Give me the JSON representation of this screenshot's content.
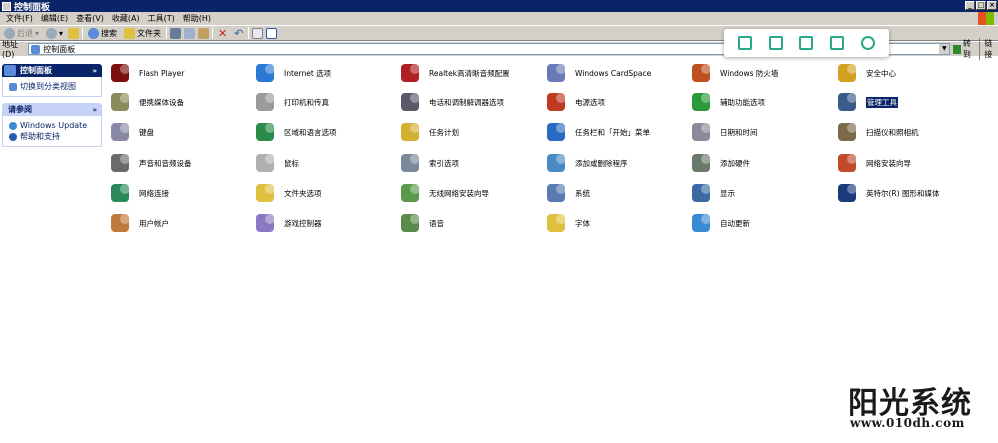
{
  "window": {
    "title": "控制面板"
  },
  "menu": [
    "文件(F)",
    "编辑(E)",
    "查看(V)",
    "收藏(A)",
    "工具(T)",
    "帮助(H)"
  ],
  "toolbar": {
    "back": "后退",
    "search": "搜索",
    "folders": "文件夹"
  },
  "address": {
    "label": "地址(D)",
    "value": "控制面板",
    "go": "转到",
    "links": "链接"
  },
  "sidebar": {
    "panel1": {
      "title": "控制面板",
      "items": [
        "切换到分类视图"
      ]
    },
    "panel2": {
      "title": "请参阅",
      "items": [
        "Windows Update",
        "帮助和支持"
      ]
    }
  },
  "items": [
    {
      "label": "Flash Player",
      "icon": "flash-player-icon",
      "color": "#7a1010"
    },
    {
      "label": "Internet 选项",
      "icon": "internet-options-icon",
      "color": "#2a7ad4"
    },
    {
      "label": "Realtek高清晰音频配置",
      "icon": "realtek-audio-icon",
      "color": "#b02020"
    },
    {
      "label": "Windows CardSpace",
      "icon": "cardspace-icon",
      "color": "#6a7ab8"
    },
    {
      "label": "Windows 防火墙",
      "icon": "firewall-icon",
      "color": "#c05020"
    },
    {
      "label": "安全中心",
      "icon": "security-center-icon",
      "color": "#d4a020"
    },
    {
      "label": "便携媒体设备",
      "icon": "portable-media-icon",
      "color": "#8a8a5a"
    },
    {
      "label": "打印机和传真",
      "icon": "printers-icon",
      "color": "#9a9a9a"
    },
    {
      "label": "电话和调制解调器选项",
      "icon": "phone-modem-icon",
      "color": "#5a5a6a"
    },
    {
      "label": "电源选项",
      "icon": "power-options-icon",
      "color": "#c03a20"
    },
    {
      "label": "辅助功能选项",
      "icon": "accessibility-icon",
      "color": "#2a9a3a"
    },
    {
      "label": "管理工具",
      "icon": "admin-tools-icon",
      "color": "#3a5a8a",
      "selected": true
    },
    {
      "label": "键盘",
      "icon": "keyboard-icon",
      "color": "#8a8aa8"
    },
    {
      "label": "区域和语言选项",
      "icon": "regional-icon",
      "color": "#2a8a4a"
    },
    {
      "label": "任务计划",
      "icon": "scheduled-tasks-icon",
      "color": "#d4b030"
    },
    {
      "label": "任务栏和「开始」菜单",
      "icon": "taskbar-icon",
      "color": "#2a6ac4"
    },
    {
      "label": "日期和时间",
      "icon": "date-time-icon",
      "color": "#8a8a9a"
    },
    {
      "label": "扫描仪和照相机",
      "icon": "scanner-camera-icon",
      "color": "#7a6a4a"
    },
    {
      "label": "声音和音频设备",
      "icon": "sound-icon",
      "color": "#6a6a6a"
    },
    {
      "label": "鼠标",
      "icon": "mouse-icon",
      "color": "#b0b0b0"
    },
    {
      "label": "索引选项",
      "icon": "indexing-icon",
      "color": "#7a8a9a"
    },
    {
      "label": "添加或删除程序",
      "icon": "add-remove-programs-icon",
      "color": "#4a8ac4"
    },
    {
      "label": "添加硬件",
      "icon": "add-hardware-icon",
      "color": "#6a7a6a"
    },
    {
      "label": "网络安装向导",
      "icon": "network-wizard-icon",
      "color": "#c04a2a"
    },
    {
      "label": "网络连接",
      "icon": "network-connections-icon",
      "color": "#2a8a5a"
    },
    {
      "label": "文件夹选项",
      "icon": "folder-options-icon",
      "color": "#e0c040"
    },
    {
      "label": "无线网络安装向导",
      "icon": "wireless-wizard-icon",
      "color": "#5a9a4a"
    },
    {
      "label": "系统",
      "icon": "system-icon",
      "color": "#5a7ab4"
    },
    {
      "label": "显示",
      "icon": "display-icon",
      "color": "#3a6aa4"
    },
    {
      "label": "英特尔(R) 图形和媒体",
      "icon": "intel-graphics-icon",
      "color": "#1a3a7a"
    },
    {
      "label": "用户帐户",
      "icon": "user-accounts-icon",
      "color": "#c07a3a"
    },
    {
      "label": "游戏控制器",
      "icon": "game-controller-icon",
      "color": "#8a7ac4"
    },
    {
      "label": "语音",
      "icon": "speech-icon",
      "color": "#5a8a4a"
    },
    {
      "label": "字体",
      "icon": "fonts-icon",
      "color": "#e0c040"
    },
    {
      "label": "自动更新",
      "icon": "automatic-updates-icon",
      "color": "#3a8ad4"
    }
  ],
  "watermark": {
    "text": "阳光系统",
    "url": "www.010dh.com"
  }
}
